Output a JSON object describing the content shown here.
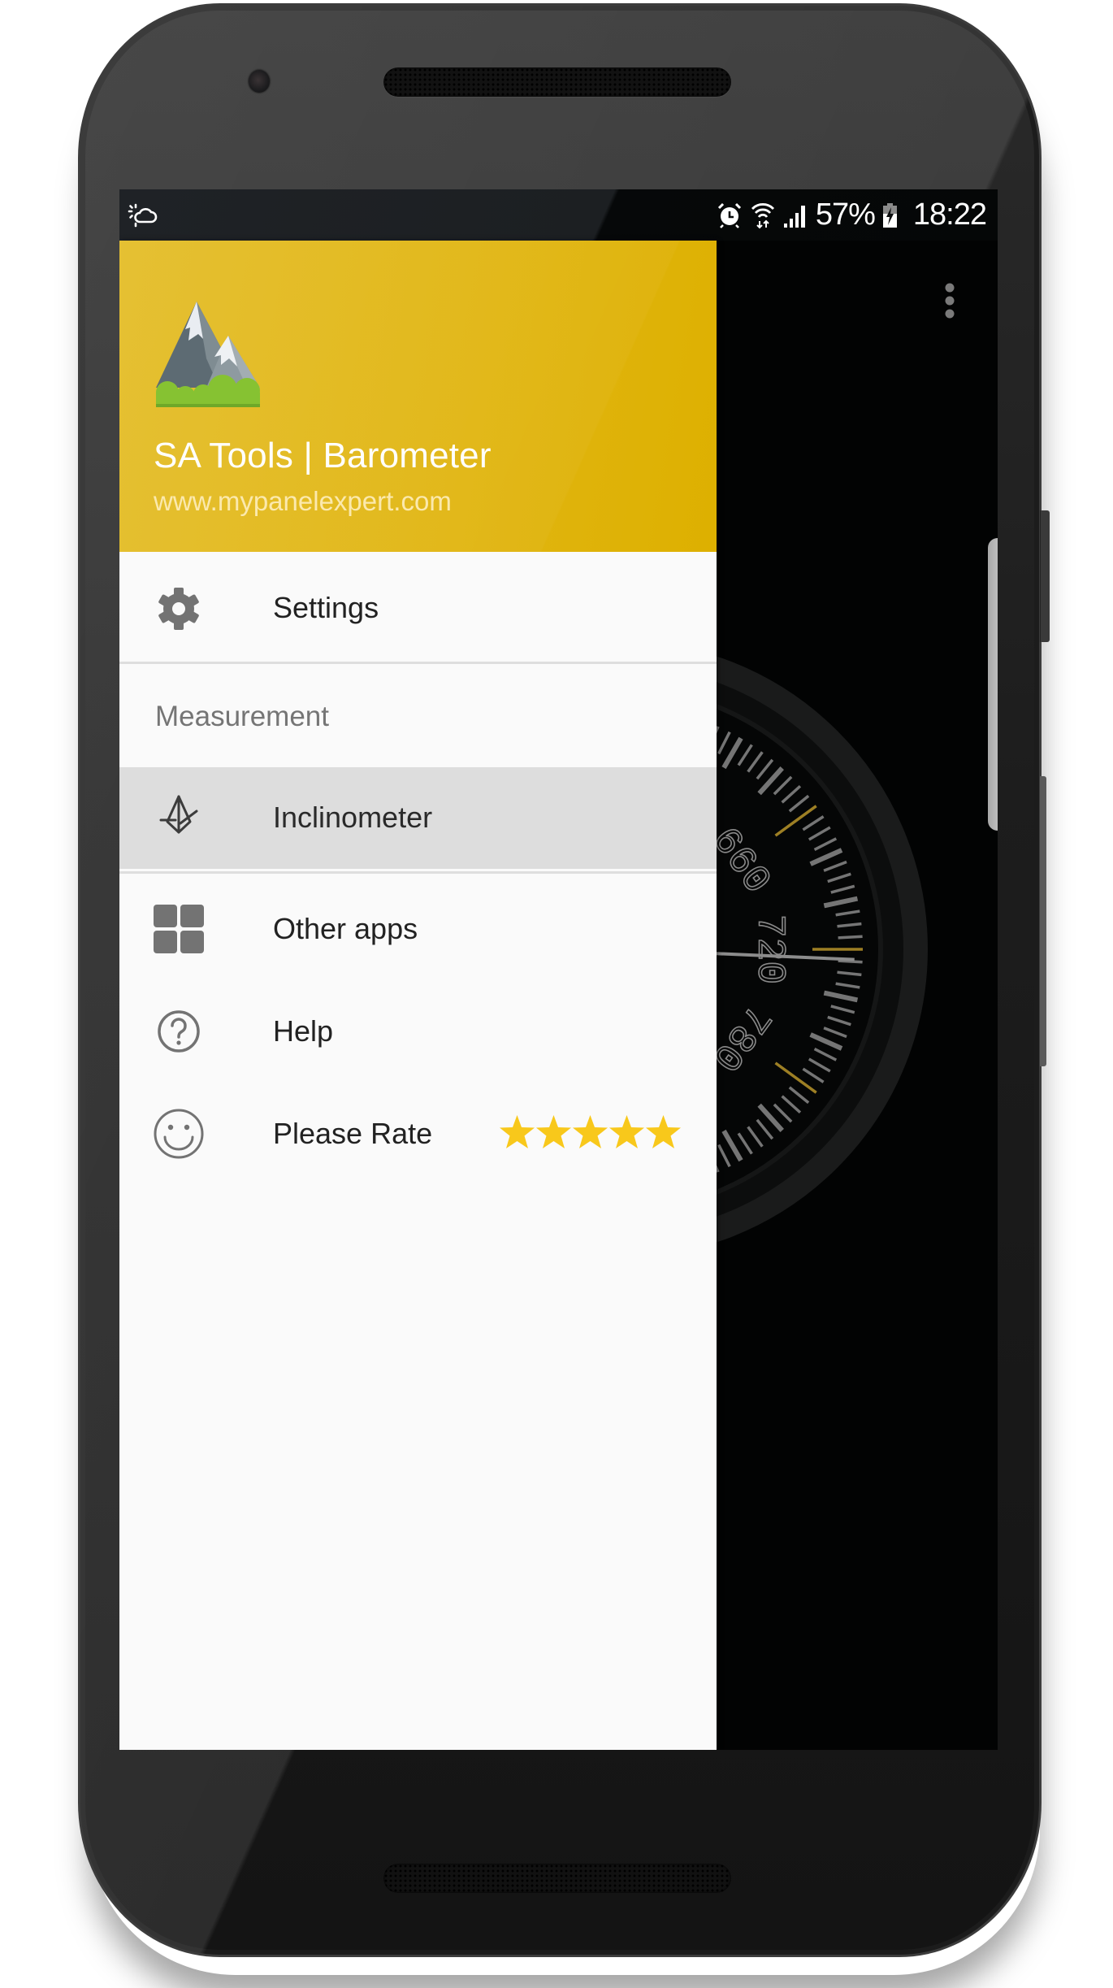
{
  "status_bar": {
    "left_icons": [
      "weather-icon"
    ],
    "right_icons": [
      "alarm-icon",
      "wifi-icon",
      "signal-icon"
    ],
    "battery_percent": "57%",
    "battery_state": "charging",
    "time": "18:22"
  },
  "app": {
    "screen_behind_drawer": "Barometer gauge",
    "overflow_menu_icon": "more-vert-icon",
    "gauge": {
      "visible_labels": [
        "660",
        "720",
        "780"
      ],
      "accent_tick_color": "#b8952a",
      "tick_color": "#8a8a8a"
    }
  },
  "drawer": {
    "header": {
      "logo_icon": "mountain-logo-icon",
      "title": "SA Tools | Barometer",
      "subtitle": "www.mypanelexpert.com",
      "background_color": "#e1b614"
    },
    "items": [
      {
        "id": "settings",
        "icon": "gear-icon",
        "label": "Settings",
        "selected": false
      },
      {
        "id": "inclinometer",
        "icon": "inclinometer-icon",
        "label": "Inclinometer",
        "selected": true
      },
      {
        "id": "other-apps",
        "icon": "grid-icon",
        "label": "Other apps",
        "selected": false
      },
      {
        "id": "help",
        "icon": "help-circle-icon",
        "label": "Help",
        "selected": false
      },
      {
        "id": "rate",
        "icon": "smiley-icon",
        "label": "Please Rate",
        "selected": false
      }
    ],
    "section_header": "Measurement",
    "rating": {
      "filled": 5,
      "max": 5,
      "star_color": "#f8c81b"
    }
  },
  "colors": {
    "accent": "#e1b614",
    "selected_row": "#dddddd",
    "drawer_bg": "#fafafa",
    "icon_gray": "#737373",
    "text_primary": "#222222",
    "text_secondary": "#757575"
  }
}
